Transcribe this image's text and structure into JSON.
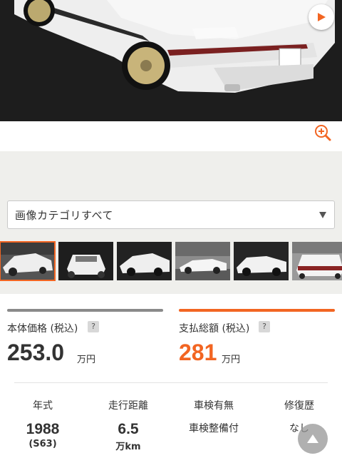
{
  "gallery": {
    "category_select": "画像カテゴリすべて",
    "thumbnails": [
      {
        "name": "thumb-1",
        "active": true
      },
      {
        "name": "thumb-2",
        "active": false
      },
      {
        "name": "thumb-3",
        "active": false
      },
      {
        "name": "thumb-4",
        "active": false
      },
      {
        "name": "thumb-5",
        "active": false
      },
      {
        "name": "thumb-6",
        "active": false
      }
    ]
  },
  "icons": {
    "play": "play-icon",
    "zoom": "zoom-in-icon",
    "caret": "caret-down-icon",
    "scroll_top": "arrow-up-icon"
  },
  "price": {
    "body_label": "本体価格 (税込)",
    "body_value": "253.0",
    "body_unit": "万円",
    "total_label": "支払総額 (税込)",
    "total_value": "281",
    "total_unit": "万円",
    "help": "?"
  },
  "specs": {
    "year_head": "年式",
    "year_value": "1988",
    "year_sub": "(S63)",
    "mileage_head": "走行距離",
    "mileage_value": "6.5",
    "mileage_unit": "万km",
    "inspection_head": "車検有無",
    "inspection_value": "車検整備付",
    "repair_head": "修復歴",
    "repair_value": "なし"
  },
  "colors": {
    "accent": "#f26522",
    "text": "#333333",
    "gallery_bg": "#efefec",
    "bar_gray": "#8a8a8a"
  }
}
